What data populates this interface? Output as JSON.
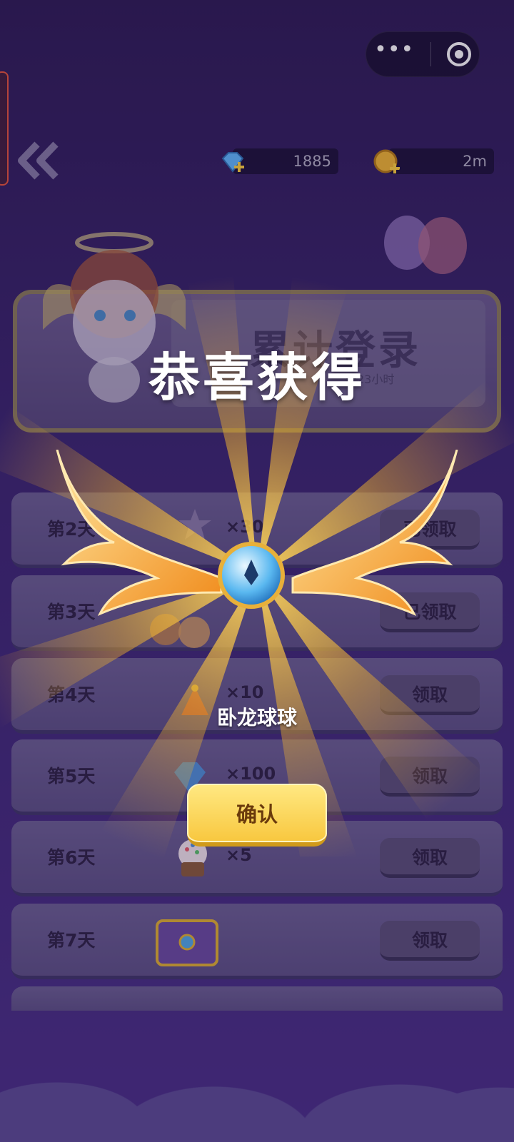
{
  "capsule": {
    "more": "•••",
    "close": "target"
  },
  "header": {
    "gems": "1885",
    "coins": "2m"
  },
  "card": {
    "title": "累计登录",
    "subtitle": "天23小时"
  },
  "rows": [
    {
      "day": "第2天",
      "qty": "×30",
      "btn": "已领取"
    },
    {
      "day": "第3天",
      "qty": "",
      "btn": "已领取"
    },
    {
      "day": "第4天",
      "qty": "×10",
      "btn": "领取"
    },
    {
      "day": "第5天",
      "qty": "×100",
      "btn": "领取"
    },
    {
      "day": "第6天",
      "qty": "×5",
      "btn": "领取"
    },
    {
      "day": "第7天",
      "qty": "",
      "btn": "领取"
    }
  ],
  "dialog": {
    "title": "恭喜获得",
    "item_name": "卧龙球球",
    "confirm": "确认"
  },
  "colors": {
    "confirm_button": "#f8c73e",
    "ray_gold": "#f5b52a"
  },
  "icons": [
    "back-chevron-icon",
    "gem-icon",
    "coin-icon",
    "more-icon",
    "close-target-icon",
    "wings-orb-icon"
  ]
}
